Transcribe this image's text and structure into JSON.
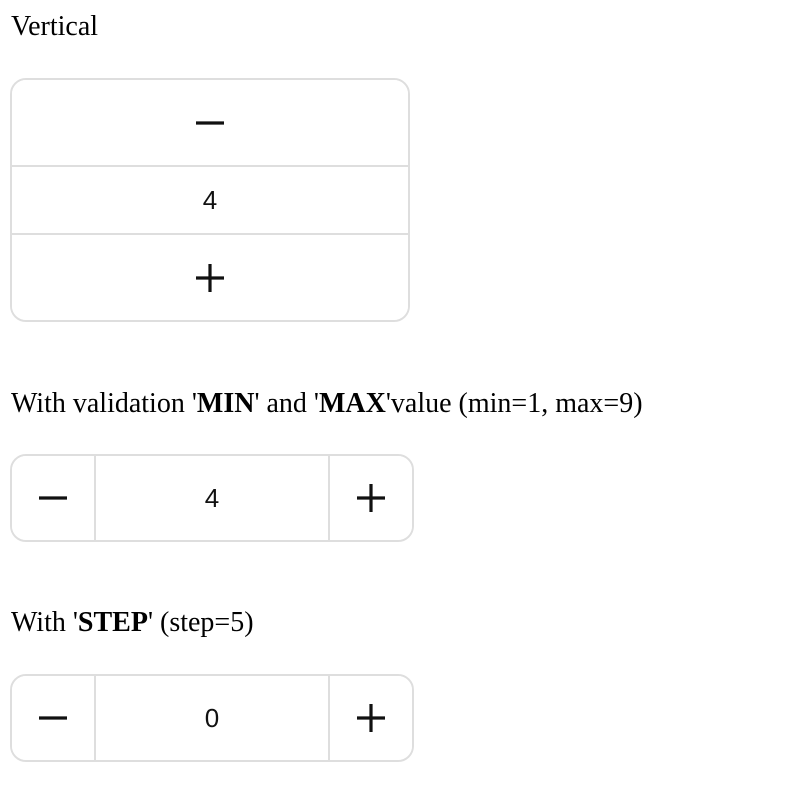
{
  "sections": {
    "vertical": {
      "label": "Vertical",
      "value": "4"
    },
    "minmax": {
      "label_parts": [
        "With validation '",
        "MIN",
        "' and '",
        "MAX",
        "'value (min=1, max=9)"
      ],
      "value": "4"
    },
    "step": {
      "label_parts": [
        "With '",
        "STEP",
        "' (step=5)"
      ],
      "value": "0"
    }
  },
  "icons": {
    "decrement": "minus-icon",
    "increment": "plus-icon"
  },
  "colors": {
    "border": "#dedede",
    "icon": "#111111"
  }
}
